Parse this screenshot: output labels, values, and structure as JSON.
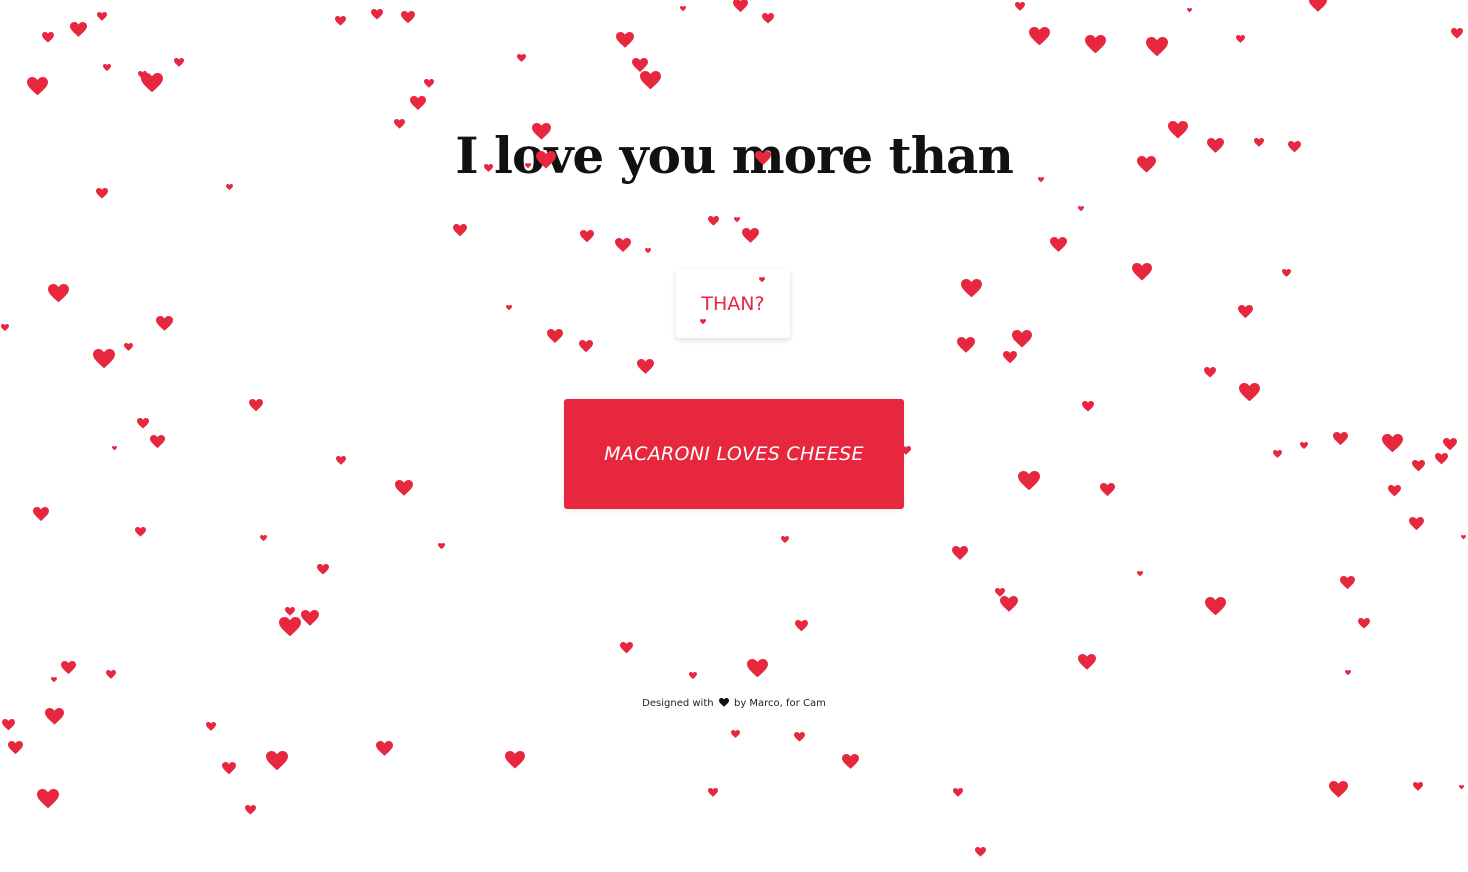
{
  "title": "I love you more than",
  "than_button_label": "THAN?",
  "answer_text": "MACARONI LOVES CHEESE",
  "footer": {
    "prefix": "Designed with",
    "suffix": "by Marco, for Cam",
    "heart_icon": "heart-icon"
  },
  "colors": {
    "accent": "#e6273e",
    "heart": "#e6273e",
    "title": "#111111",
    "background": "#ffffff"
  },
  "decoration": {
    "icon": "heart-icon"
  }
}
